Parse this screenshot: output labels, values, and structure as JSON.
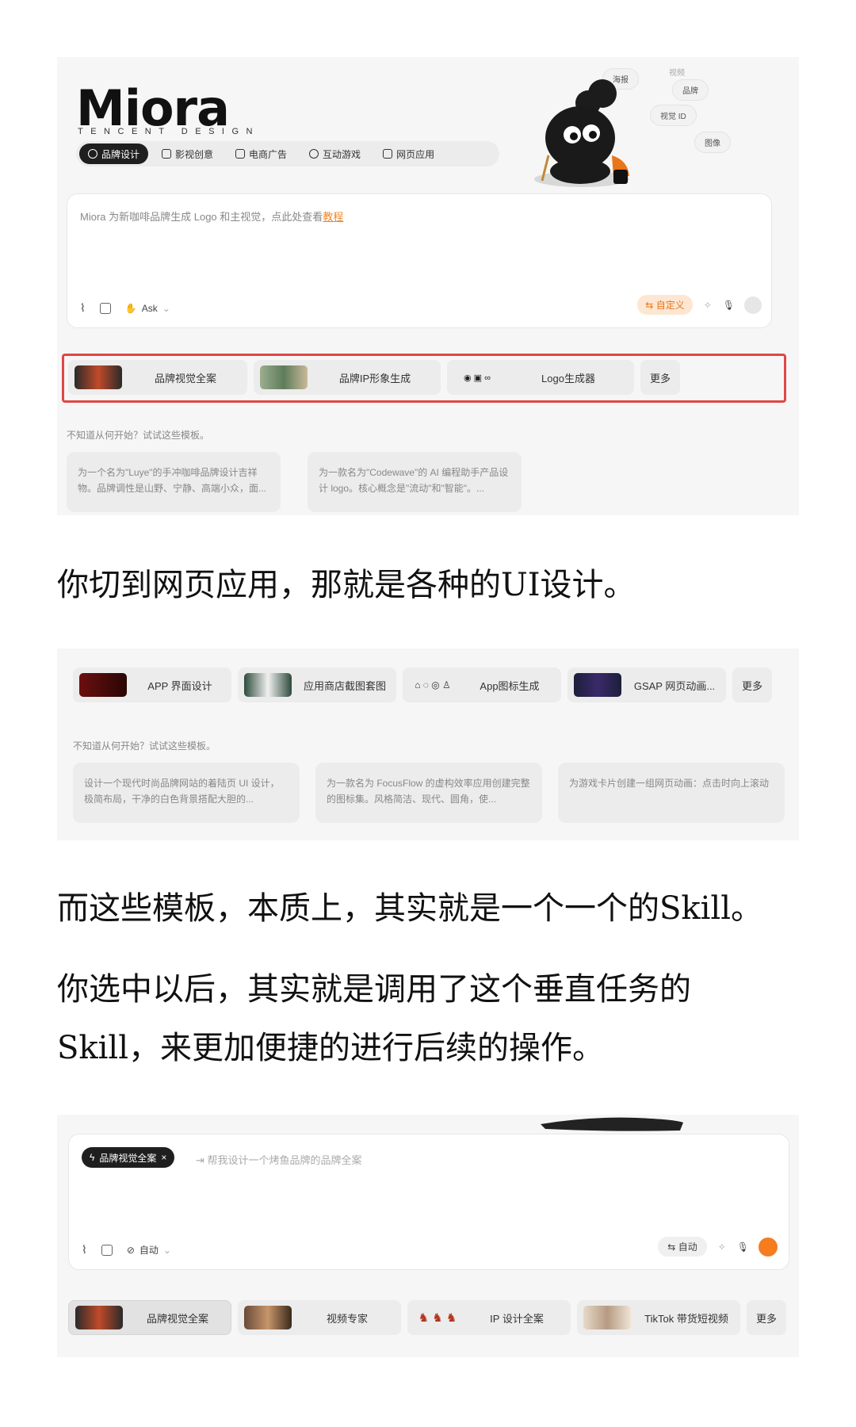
{
  "shot1": {
    "logo": "Miora",
    "logo_sub": "TENCENT DESIGN",
    "tabs": [
      "品牌设计",
      "影视创意",
      "电商广告",
      "互动游戏",
      "网页应用"
    ],
    "bubbles": [
      "海报",
      "视频",
      "品牌",
      "视觉 ID",
      "图像"
    ],
    "placeholder": "Miora 为新咖啡品牌生成 Logo 和主视觉，点此处查看",
    "placeholder_link": "教程",
    "ask_label": "Ask",
    "custom_label": "自定义",
    "chips": [
      "品牌视觉全案",
      "品牌IP形象生成",
      "Logo生成器"
    ],
    "more": "更多",
    "hint": "不知道从何开始？试试这些模板。",
    "cards": [
      "为一个名为\"Luye\"的手冲咖啡品牌设计吉祥物。品牌调性是山野、宁静、高端小众，面...",
      "为一款名为\"Codewave\"的 AI 编程助手产品设计 logo。核心概念是\"流动\"和\"智能\"。..."
    ]
  },
  "para1": "你切到网页应用，那就是各种的UI设计。",
  "shot2": {
    "chips": [
      "APP 界面设计",
      "应用商店截图套图",
      "App图标生成",
      "GSAP 网页动画..."
    ],
    "more": "更多",
    "hint": "不知道从何开始？试试这些模板。",
    "cards": [
      "设计一个现代时尚品牌网站的着陆页 UI 设计，极简布局，干净的白色背景搭配大胆的...",
      "为一款名为 FocusFlow 的虚构效率应用创建完整的图标集。风格简洁、现代、圆角，使...",
      "为游戏卡片创建一组网页动画：点击时向上滚动"
    ]
  },
  "para2": "而这些模板，本质上，其实就是一个一个的Skill。",
  "para3": "你选中以后，其实就是调用了这个垂直任务的",
  "para4": "Skill，来更加便捷的进行后续的操作。",
  "shot3": {
    "tag": "品牌视觉全案",
    "tag_close": "×",
    "placeholder": "帮我设计一个烤鱼品牌的品牌全案",
    "auto_left": "自动",
    "auto_right": "自动",
    "chips": [
      "品牌视觉全案",
      "视频专家",
      "IP 设计全案",
      "TikTok 带货短视频"
    ],
    "more": "更多"
  },
  "colors": {
    "accent": "#f57c1f",
    "highlight": "#e04646",
    "dark_pill": "#1f1f1f"
  }
}
